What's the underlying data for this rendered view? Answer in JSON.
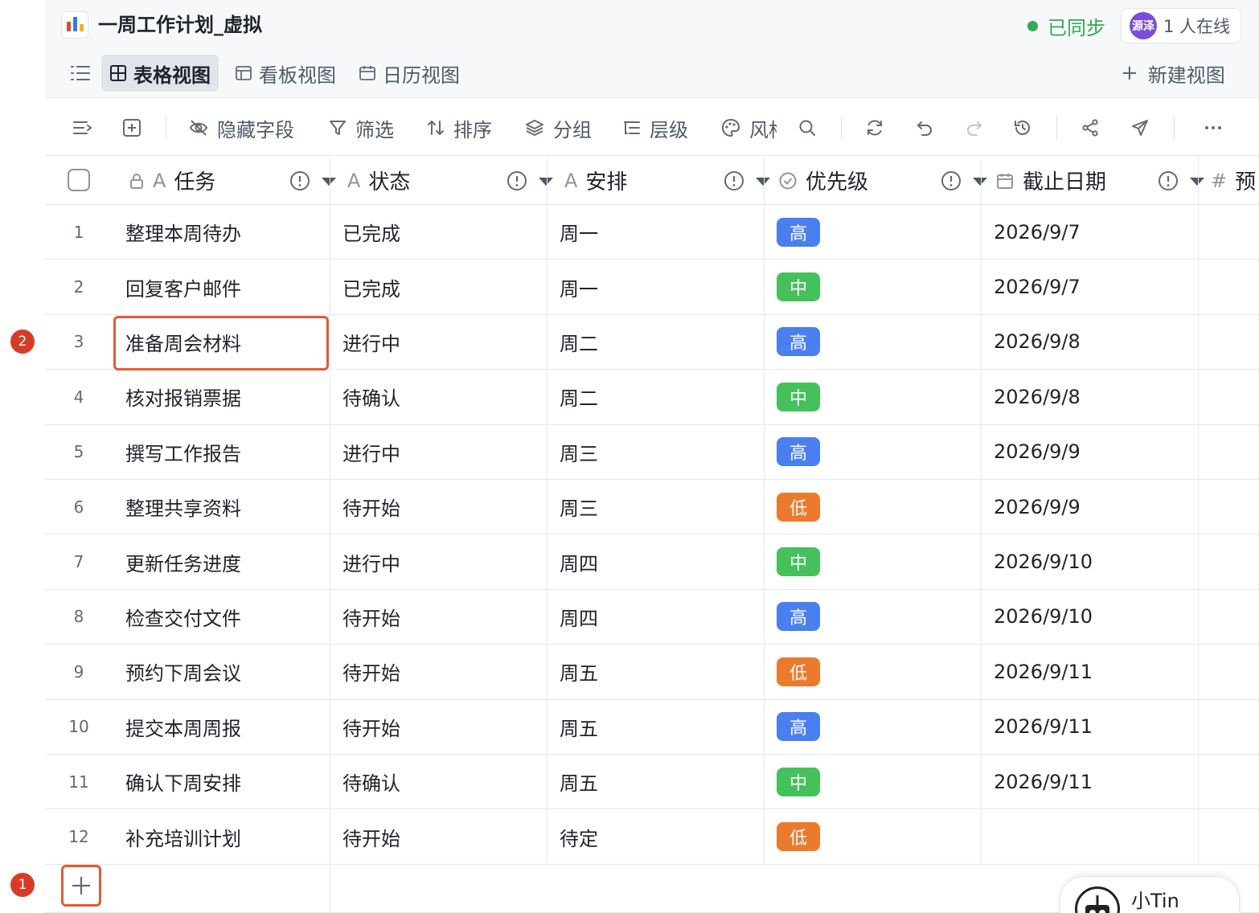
{
  "header": {
    "title": "一周工作计划_虚拟",
    "sync_status": "已同步",
    "avatar_text": "源泽",
    "online_text": "1 人在线"
  },
  "tabs": [
    {
      "label": "表格视图",
      "icon": "grid-icon",
      "active": true
    },
    {
      "label": "看板视图",
      "icon": "kanban-icon",
      "active": false
    },
    {
      "label": "日历视图",
      "icon": "calendar-icon",
      "active": false
    }
  ],
  "new_view_label": "新建视图",
  "toolbar": {
    "hide_fields": "隐藏字段",
    "filter": "筛选",
    "sort": "排序",
    "group": "分组",
    "hierarchy": "层级",
    "style": "风格"
  },
  "columns": {
    "task": "任务",
    "status": "状态",
    "schedule": "安排",
    "priority": "优先级",
    "due_date": "截止日期",
    "estimate": "预"
  },
  "rows": [
    {
      "n": "1",
      "task": "整理本周待办",
      "status": "已完成",
      "schedule": "周一",
      "priority": "高",
      "date": "2026/9/7"
    },
    {
      "n": "2",
      "task": "回复客户邮件",
      "status": "已完成",
      "schedule": "周一",
      "priority": "中",
      "date": "2026/9/7"
    },
    {
      "n": "3",
      "task": "准备周会材料",
      "status": "进行中",
      "schedule": "周二",
      "priority": "高",
      "date": "2026/9/8"
    },
    {
      "n": "4",
      "task": "核对报销票据",
      "status": "待确认",
      "schedule": "周二",
      "priority": "中",
      "date": "2026/9/8"
    },
    {
      "n": "5",
      "task": "撰写工作报告",
      "status": "进行中",
      "schedule": "周三",
      "priority": "高",
      "date": "2026/9/9"
    },
    {
      "n": "6",
      "task": "整理共享资料",
      "status": "待开始",
      "schedule": "周三",
      "priority": "低",
      "date": "2026/9/9"
    },
    {
      "n": "7",
      "task": "更新任务进度",
      "status": "进行中",
      "schedule": "周四",
      "priority": "中",
      "date": "2026/9/10"
    },
    {
      "n": "8",
      "task": "检查交付文件",
      "status": "待开始",
      "schedule": "周四",
      "priority": "高",
      "date": "2026/9/10"
    },
    {
      "n": "9",
      "task": "预约下周会议",
      "status": "待开始",
      "schedule": "周五",
      "priority": "低",
      "date": "2026/9/11"
    },
    {
      "n": "10",
      "task": "提交本周周报",
      "status": "待开始",
      "schedule": "周五",
      "priority": "高",
      "date": "2026/9/11"
    },
    {
      "n": "11",
      "task": "确认下周安排",
      "status": "待确认",
      "schedule": "周五",
      "priority": "中",
      "date": "2026/9/11"
    },
    {
      "n": "12",
      "task": "补充培训计划",
      "status": "待开始",
      "schedule": "待定",
      "priority": "低",
      "date": ""
    }
  ],
  "priority_colors": {
    "高": "#4a7ff0",
    "中": "#45c15b",
    "低": "#ec7a2c"
  },
  "markers": {
    "add_row": "1",
    "selected_cell": "2"
  },
  "assistant": {
    "name": "小Tin"
  }
}
